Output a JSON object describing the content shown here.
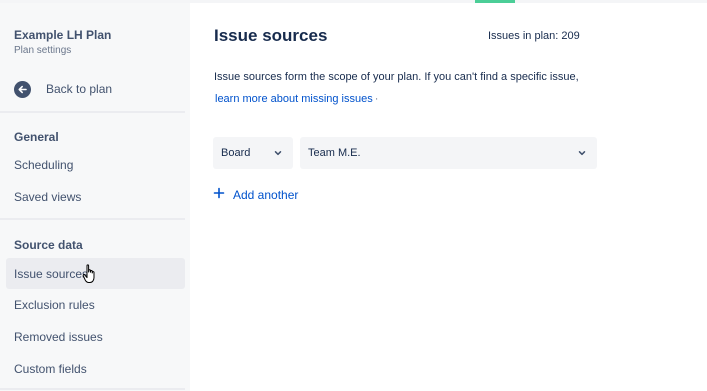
{
  "colors": {
    "sidebar_bg": "#f7f8f9",
    "selected_bg": "#ebecf0",
    "link": "#0052cc",
    "text": "#172b4d",
    "muted": "#42526e",
    "accent_top": "#4bce97"
  },
  "sidebar": {
    "plan_name": "Example LH Plan",
    "plan_subtitle": "Plan settings",
    "back_label": "Back to plan",
    "back_icon": "arrow-left-circle-icon",
    "sections": [
      {
        "title": "General",
        "items": [
          {
            "label": "Scheduling"
          },
          {
            "label": "Saved views"
          }
        ]
      },
      {
        "title": "Source data",
        "items": [
          {
            "label": "Issue sources",
            "selected": true
          },
          {
            "label": "Exclusion rules"
          },
          {
            "label": "Removed issues"
          },
          {
            "label": "Custom fields"
          }
        ]
      }
    ]
  },
  "main": {
    "title": "Issue sources",
    "issues_in_plan": "Issues in plan: 209",
    "description": "Issue sources form the scope of your plan. If you can't find a specific issue,",
    "learn_more": "learn more about missing issues",
    "learn_more_suffix": "·",
    "source_row": {
      "type_value": "Board",
      "source_value": "Team M.E."
    },
    "add_another": "Add another",
    "add_icon": "plus-icon"
  }
}
